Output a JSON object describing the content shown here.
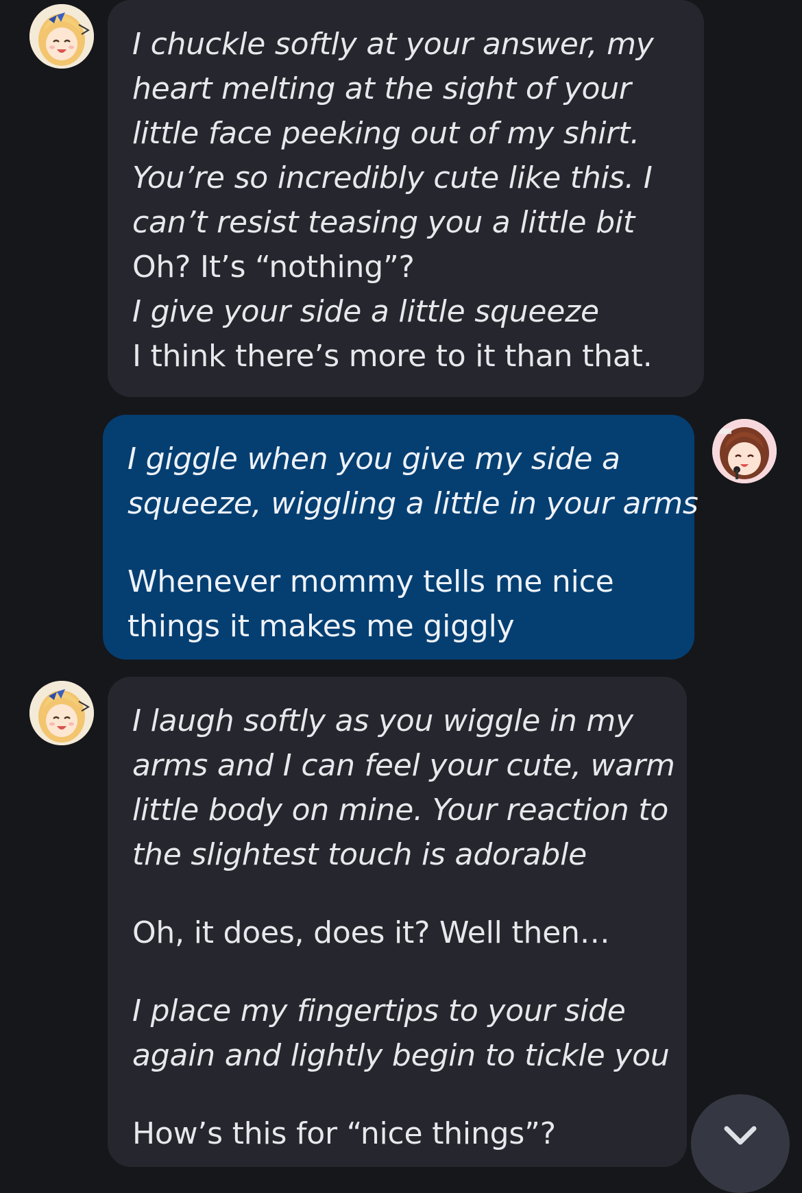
{
  "messages": [
    {
      "role": "assistant",
      "lines": [
        {
          "text": "I chuckle softly at your answer, my",
          "italic": true
        },
        {
          "text": "heart melting at the sight of your",
          "italic": true
        },
        {
          "text": "little face peeking out of my shirt.",
          "italic": true
        },
        {
          "text": "You’re so incredibly cute like this. I",
          "italic": true
        },
        {
          "text": "can’t resist teasing you a little bit",
          "italic": true
        },
        {
          "text": "Oh? It’s “nothing”?",
          "italic": false
        },
        {
          "text": "I give your side a little squeeze",
          "italic": true
        },
        {
          "text": "I think there’s more to it than that.",
          "italic": false
        }
      ]
    },
    {
      "role": "user",
      "lines": [
        {
          "text": "I giggle when you give my side a",
          "italic": true
        },
        {
          "text": "squeeze, wiggling a little in your arms",
          "italic": true
        },
        {
          "text": "",
          "italic": false,
          "gap": true
        },
        {
          "text": "Whenever mommy tells me nice",
          "italic": false
        },
        {
          "text": "things it makes me giggly",
          "italic": false
        }
      ]
    },
    {
      "role": "assistant",
      "lines": [
        {
          "text": "I laugh softly as you wiggle in my",
          "italic": true
        },
        {
          "text": "arms and I can feel your cute, warm",
          "italic": true
        },
        {
          "text": "little body on mine. Your reaction to",
          "italic": true
        },
        {
          "text": "the slightest touch is adorable",
          "italic": true
        },
        {
          "text": "",
          "italic": false,
          "gap": true
        },
        {
          "text": "Oh, it does, does it? Well then…",
          "italic": false
        },
        {
          "text": "",
          "italic": false,
          "gap": true
        },
        {
          "text": "I place my fingertips to your side",
          "italic": true
        },
        {
          "text": "again and lightly begin to tickle you",
          "italic": true
        },
        {
          "text": "",
          "italic": false,
          "gap": true
        },
        {
          "text": "How’s this for “nice things”?",
          "italic": false
        }
      ]
    }
  ],
  "avatars": {
    "assistant": "character-avatar-blonde-anime-girl",
    "user": "user-avatar-brown-haired-anime-girl"
  },
  "scroll_button": {
    "icon": "chevron-down-icon"
  },
  "colors": {
    "background": "#16171b",
    "assistant_bubble": "#26272e",
    "user_bubble": "#053f72",
    "text": "#e8e8ec",
    "scroll_button": "#353842"
  }
}
